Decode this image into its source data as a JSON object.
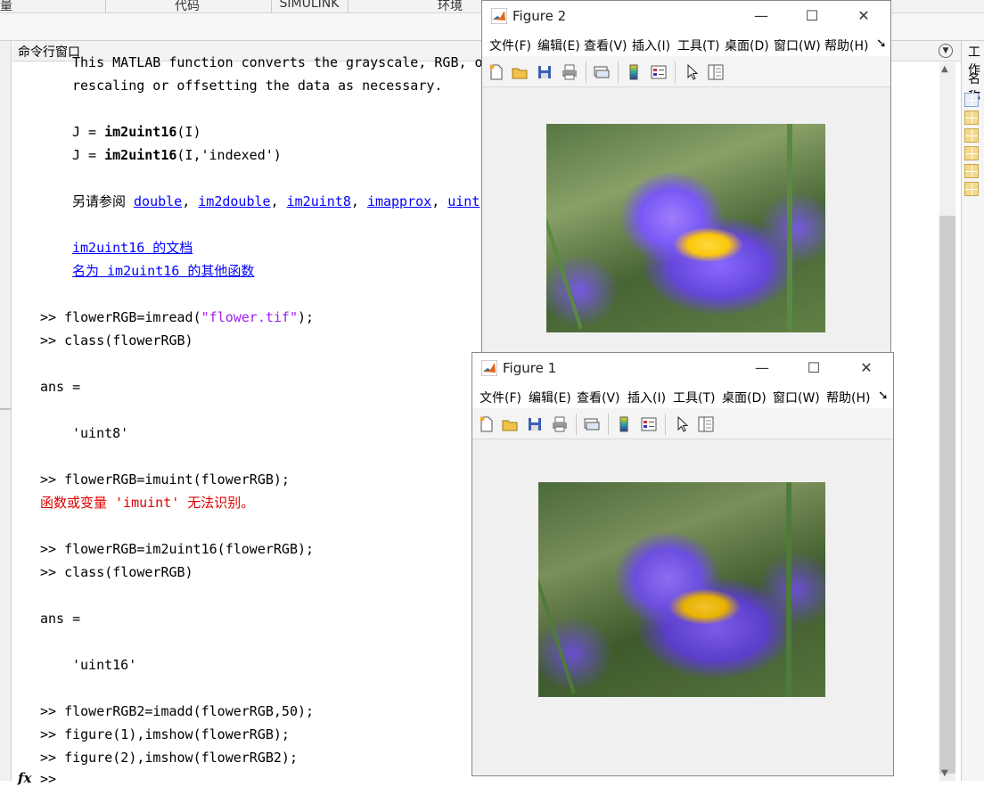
{
  "ribbon": {
    "sections": [
      "量",
      "代码",
      "SIMULINK",
      "环境"
    ]
  },
  "command_window": {
    "title": "命令行窗口",
    "lines": {
      "l1": "This MATLAB function converts the grayscale, RGB, o",
      "l2": "rescaling or offsetting the data as necessary.",
      "l3_prefix": "J = ",
      "l3_fn": "im2uint16",
      "l3_suffix": "(I)",
      "l4_prefix": "J = ",
      "l4_fn": "im2uint16",
      "l4_suffix": "(I,'indexed')",
      "see_also_label": "另请参阅 ",
      "see_also_links": [
        "double",
        "im2double",
        "im2uint8",
        "imapprox",
        "uint"
      ],
      "doc_link": "im2uint16 的文档",
      "other_link": "名为 im2uint16 的其他函数",
      "c1_pre": ">> flowerRGB=imread(",
      "c1_str": "\"flower.tif\"",
      "c1_post": ");",
      "c2": ">> class(flowerRGB)",
      "ans1": "ans =",
      "val1": "'uint8'",
      "c3": ">> flowerRGB=imuint(flowerRGB);",
      "err1": "函数或变量 'imuint' 无法识别。",
      "c4": ">> flowerRGB=im2uint16(flowerRGB);",
      "c5": ">> class(flowerRGB)",
      "ans2": "ans =",
      "val2": "'uint16'",
      "c6": ">> flowerRGB2=imadd(flowerRGB,50);",
      "c7": ">> figure(1),imshow(flowerRGB);",
      "c8": ">> figure(2),imshow(flowerRGB2);",
      "c9": ">>"
    },
    "fx_label": "fx"
  },
  "workspace": {
    "title": "工作",
    "name_col": "名称"
  },
  "figure2": {
    "title": "Figure 2",
    "menu": [
      "文件(F)",
      "编辑(E)",
      "查看(V)",
      "插入(I)",
      "工具(T)",
      "桌面(D)",
      "窗口(W)",
      "帮助(H)"
    ]
  },
  "figure1": {
    "title": "Figure 1",
    "menu": [
      "文件(F)",
      "编辑(E)",
      "查看(V)",
      "插入(I)",
      "工具(T)",
      "桌面(D)",
      "窗口(W)",
      "帮助(H)"
    ]
  },
  "window_controls": {
    "minimize": "—",
    "maximize": "☐",
    "close": "✕",
    "overflow": "➘"
  },
  "colors": {
    "link": "#0000ff",
    "string": "#a020f0",
    "error": "#e00000"
  }
}
